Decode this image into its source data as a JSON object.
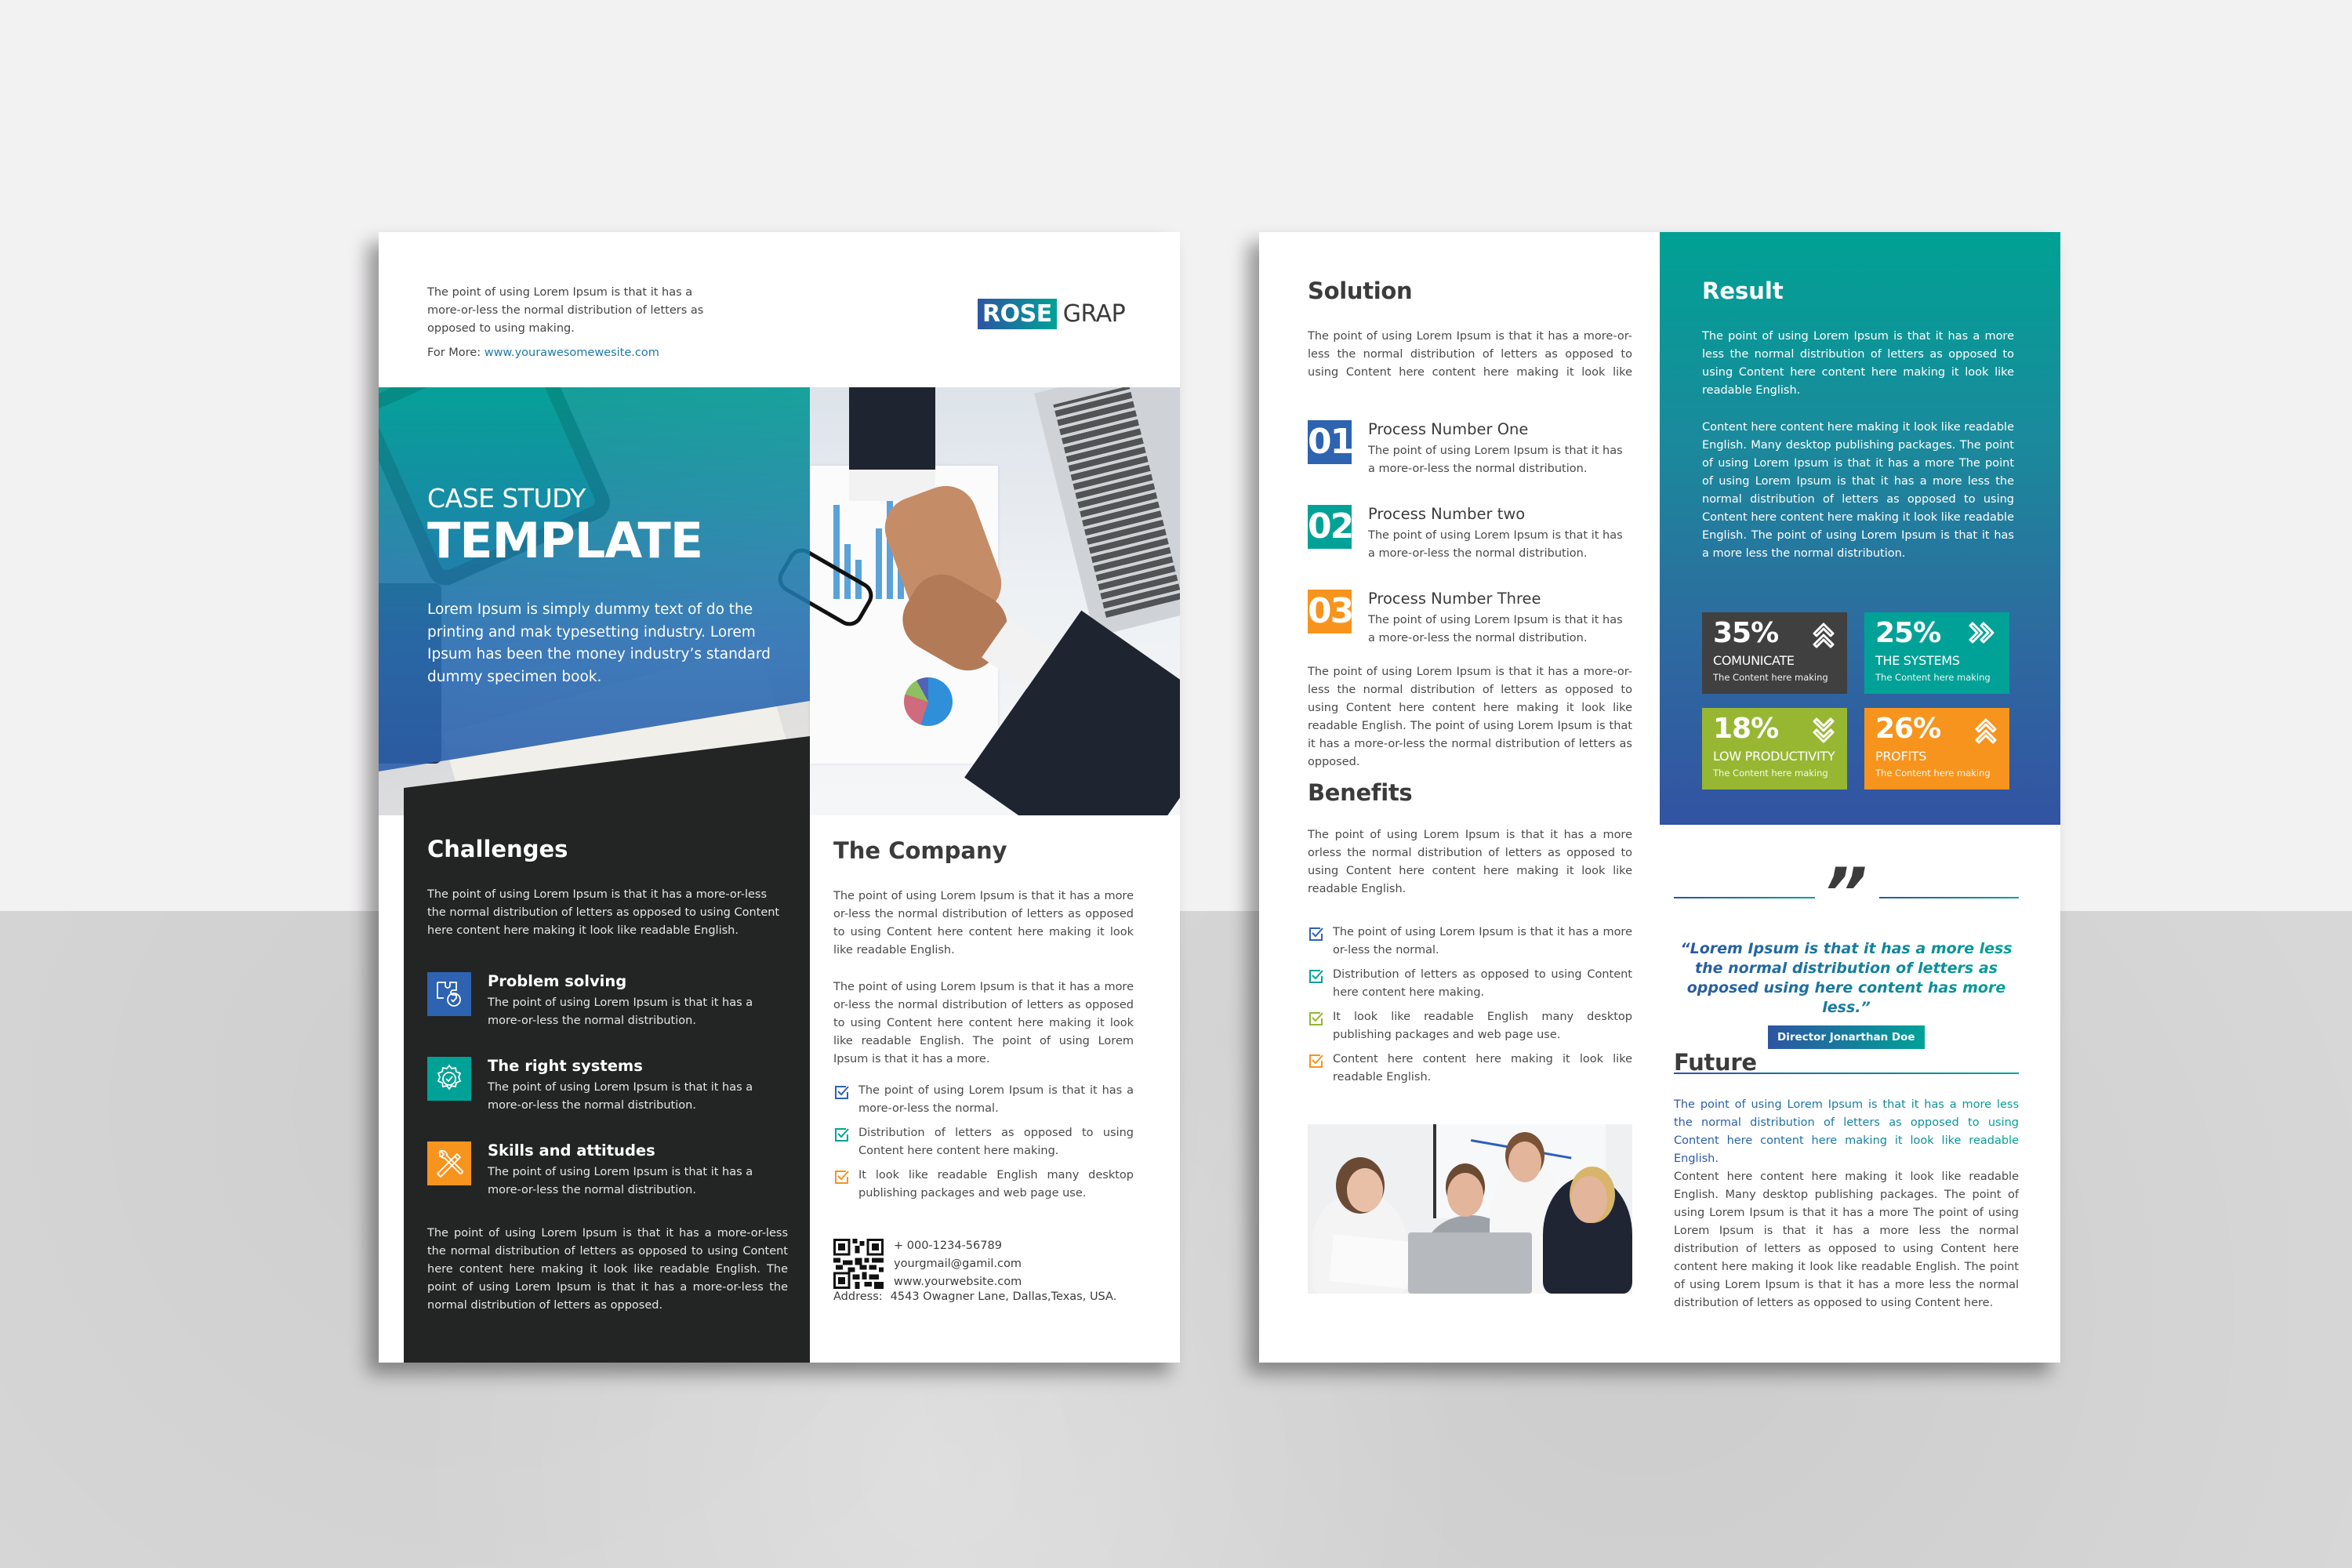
{
  "colors": {
    "blue": "#2d63b0",
    "teal": "#00a297",
    "orange": "#f7941d",
    "green": "#97b733",
    "dark": "#232424",
    "stat_dark": "#404040"
  },
  "page1": {
    "intro": "The point of using Lorem Ipsum is that it has a more-or-less the normal distribution of letters as opposed to using making.",
    "for_more_label": "For More:",
    "for_more_link": "www.yourawesomewesite.com",
    "logo": {
      "highlight": "ROSE",
      "rest": "GRAP"
    },
    "hero": {
      "subtitle": "CASE STUDY",
      "title": "TEMPLATE",
      "description": "Lorem Ipsum is simply dummy text of do the printing and mak typesetting industry. Lorem Ipsum has been the money industry’s standard dummy specimen book."
    },
    "challenges": {
      "title": "Challenges",
      "intro": "The point of using Lorem Ipsum is that it has a more-or-less the normal distribution of letters as opposed to using Content here content here making it look like readable English.",
      "items": [
        {
          "icon": "puzzle-gear-icon",
          "title": "Problem solving",
          "text": "The point of using Lorem Ipsum is that it has a more-or-less the normal distribution."
        },
        {
          "icon": "gear-check-icon",
          "title": "The right systems",
          "text": "The point of using Lorem Ipsum is that it has a more-or-less the normal distribution."
        },
        {
          "icon": "tools-icon",
          "title": "Skills and attitudes",
          "text": "The point of using Lorem Ipsum is that it has a more-or-less the normal distribution."
        }
      ],
      "outro": "The point of using Lorem Ipsum is that it has a more-or-less the normal distribution of letters as opposed to using Content here content here making it look like readable English. The point of using Lorem Ipsum is that it has a more-or-less the normal distribution of letters as opposed."
    },
    "company": {
      "title": "The Company",
      "p1": "The point of using Lorem Ipsum is that it has a more or-less the normal distribution of letters as opposed to using Content here content here making it look like readable English.",
      "p2": "The point of using Lorem Ipsum is that it has a more or-less the normal distribution of letters as opposed to using Content here content here making it look like readable English. The point of using Lorem Ipsum is that it has a more.",
      "checks": [
        "The point of using Lorem Ipsum is that it has a more-or-less the normal.",
        "Distribution of letters as opposed to using Content here content here making.",
        "It look like readable English many desktop publishing packages and web page use."
      ],
      "contact": {
        "phone": "+ 000-1234-56789",
        "email": "yourgmail@gamil.com",
        "website": "www.yourwebsite.com",
        "address_label": "Address:",
        "address": "4543  Owagner Lane, Dallas,Texas, USA."
      }
    }
  },
  "page2": {
    "solution": {
      "title": "Solution",
      "intro": "The point of using Lorem Ipsum is that it has a more-or-less the normal distribution of letters as opposed to using Content here content here making it look like readable",
      "processes": [
        {
          "number": "01",
          "title": "Process Number One",
          "text": "The point of using Lorem Ipsum is that it has a more-or-less the normal distribution."
        },
        {
          "number": "02",
          "title": "Process Number two",
          "text": "The point of using Lorem Ipsum is that it has a more-or-less the normal distribution."
        },
        {
          "number": "03",
          "title": "Process Number Three",
          "text": "The point of using Lorem Ipsum is that it has a more-or-less the normal distribution."
        }
      ],
      "outro": "The point of using Lorem Ipsum is that it has a more-or-less the normal distribution of letters as opposed to using Content here content here making it look like readable English. The point of using Lorem Ipsum is that it has a more-or-less the normal distribution of letters as opposed."
    },
    "benefits": {
      "title": "Benefits",
      "intro": "The point of using Lorem Ipsum is that it has a more orless the normal distribution of letters as opposed to using Content here content here making it look like readable English.",
      "checks": [
        "The point of using Lorem Ipsum is that it has a more or-less the normal.",
        "Distribution of letters as opposed to using Content here content here making.",
        "It look like readable English many desktop publishing packages and web page use.",
        "Content here content here making it look like readable English."
      ]
    },
    "result": {
      "title": "Result",
      "p1": "The point of using Lorem Ipsum is that it has a more less the normal distribution of letters as opposed to using Content here content here making it look like readable English.",
      "p2": "Content here content here making it look like readable English. Many desktop publishing packages. The point of using Lorem Ipsum is that it has a more  The point of using Lorem Ipsum is that it has a more   less the normal distribution of letters as opposed to using Content here content here making it look like readable English. The point of using Lorem Ipsum is that it has a more less the normal distribution.",
      "stats": [
        {
          "value": "35%",
          "label": "COMUNICATE",
          "sub": "The Content here  making",
          "arrow": "double-chevron-up-icon"
        },
        {
          "value": "25%",
          "label": "THE SYSTEMS",
          "sub": "The Content here  making",
          "arrow": "double-chevron-right-icon"
        },
        {
          "value": "18%",
          "label": "LOW PRODUCTIVITY",
          "sub": "The Content here  making",
          "arrow": "double-chevron-down-icon"
        },
        {
          "value": "26%",
          "label": "PROFITS",
          "sub": "The Content here  making",
          "arrow": "double-chevron-up-icon"
        }
      ]
    },
    "quote": {
      "mark": "”",
      "text": "“Lorem Ipsum is that it has a more   less the normal distribution of letters as opposed using here content has more less.”",
      "author": "Director Jonarthan Doe"
    },
    "future": {
      "title": "Future",
      "p1": "The point of using Lorem Ipsum is that it has a more   less the normal distribution of letters as opposed to using Content here content here making it look like readable English.",
      "p2": "Content here content here making it look like readable English. Many desktop publishing packages. The point of using Lorem Ipsum is that it has a more  The point of using Lorem Ipsum is that it has a more   less the normal distribution of letters as opposed to using Content here content here making it look like readable English. The point of using Lorem Ipsum is that it has a more   less the normal distribution of letters as opposed to using Content here."
    }
  }
}
